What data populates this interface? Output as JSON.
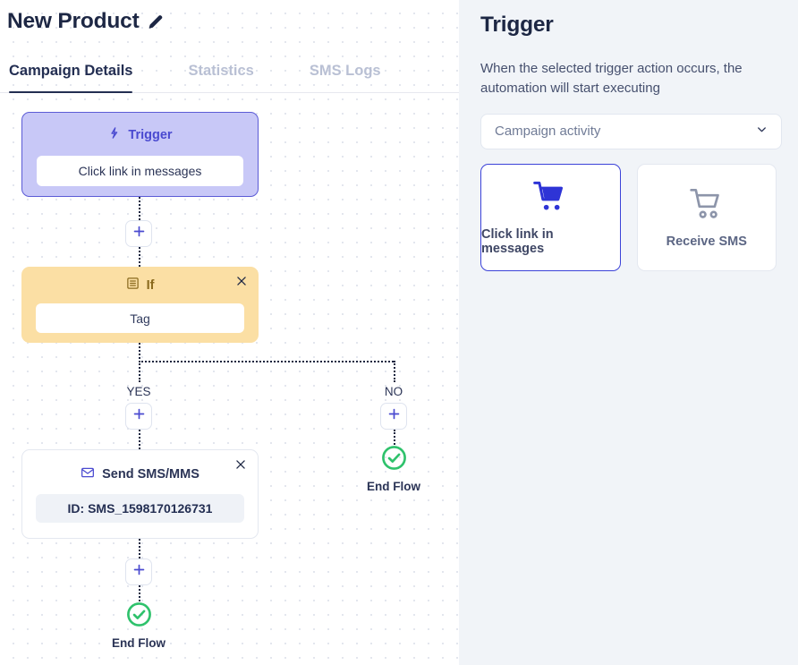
{
  "header": {
    "title": "New Product",
    "edit_icon": "pencil-icon",
    "tabs": [
      {
        "label": "Campaign Details",
        "active": true
      },
      {
        "label": "Statistics",
        "active": false
      },
      {
        "label": "SMS Logs",
        "active": false
      }
    ]
  },
  "flow": {
    "trigger_node": {
      "icon": "lightning-bolt-icon",
      "title": "Trigger",
      "value": "Click link in messages"
    },
    "if_node": {
      "icon": "list-icon",
      "title": "If",
      "value": "Tag",
      "close_icon": "close-icon"
    },
    "sms_node": {
      "icon": "envelope-icon",
      "title": "Send SMS/MMS",
      "value": "ID: SMS_1598170126731",
      "close_icon": "close-icon"
    },
    "branch_yes_label": "YES",
    "branch_no_label": "NO",
    "end_flow_label": "End Flow",
    "end_flow_label_no": "End Flow",
    "add_icon": "plus-icon",
    "end_icon": "check-circle-icon",
    "accent_indigo": "#4a4ad0",
    "end_green": "#2fc26c"
  },
  "panel": {
    "title": "Trigger",
    "description": "When the selected trigger action occurs, the automation will start executing",
    "select": {
      "value": "Campaign activity",
      "chevron_icon": "chevron-down-icon"
    },
    "options": [
      {
        "label": "Click link in messages",
        "icon": "shopping-cart-filled-icon",
        "selected": true
      },
      {
        "label": "Receive SMS",
        "icon": "shopping-cart-outline-icon",
        "selected": false
      }
    ]
  }
}
